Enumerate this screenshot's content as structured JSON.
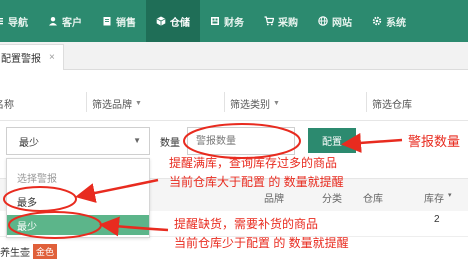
{
  "nav": {
    "items": [
      {
        "label": "导航",
        "icon": "menu-icon"
      },
      {
        "label": "客户",
        "icon": "user-icon"
      },
      {
        "label": "销售",
        "icon": "document-icon"
      },
      {
        "label": "仓储",
        "icon": "cube-icon",
        "active": true
      },
      {
        "label": "财务",
        "icon": "finance-icon"
      },
      {
        "label": "采购",
        "icon": "cart-icon"
      },
      {
        "label": "网站",
        "icon": "globe-icon"
      },
      {
        "label": "系统",
        "icon": "gear-icon"
      }
    ]
  },
  "tab": {
    "label": "配置警报",
    "close": "×"
  },
  "filters": [
    "名称",
    "筛选品牌",
    "筛选类别",
    "筛选仓库"
  ],
  "form": {
    "select_value": "最少",
    "quantity_label": "数量",
    "quantity_placeholder": "警报数量",
    "config_button": "配置"
  },
  "dropdown": {
    "options": [
      "选择警报",
      "最多",
      "最少"
    ],
    "selected_index": 2
  },
  "table": {
    "headers": [
      "品牌",
      "分类",
      "仓库",
      "库存"
    ],
    "row_qty": "2",
    "product_name": "养生壶",
    "product_tag": "金色"
  },
  "annotations": {
    "alert_quantity": "警报数量",
    "max_line1": "提醒满库，查询库存过多的商品",
    "max_line2": "当前仓库大于配置 的 数量就提醒",
    "min_line1": "提醒缺货，需要补货的商品",
    "min_line2": "当前仓库少于配置 的 数量就提醒"
  },
  "colors": {
    "nav_bg": "#2c8a6f",
    "nav_active": "#1f6e57",
    "accent_green": "#5cb58a",
    "annotation_red": "#e82b1f",
    "tag_orange": "#e0603a"
  }
}
